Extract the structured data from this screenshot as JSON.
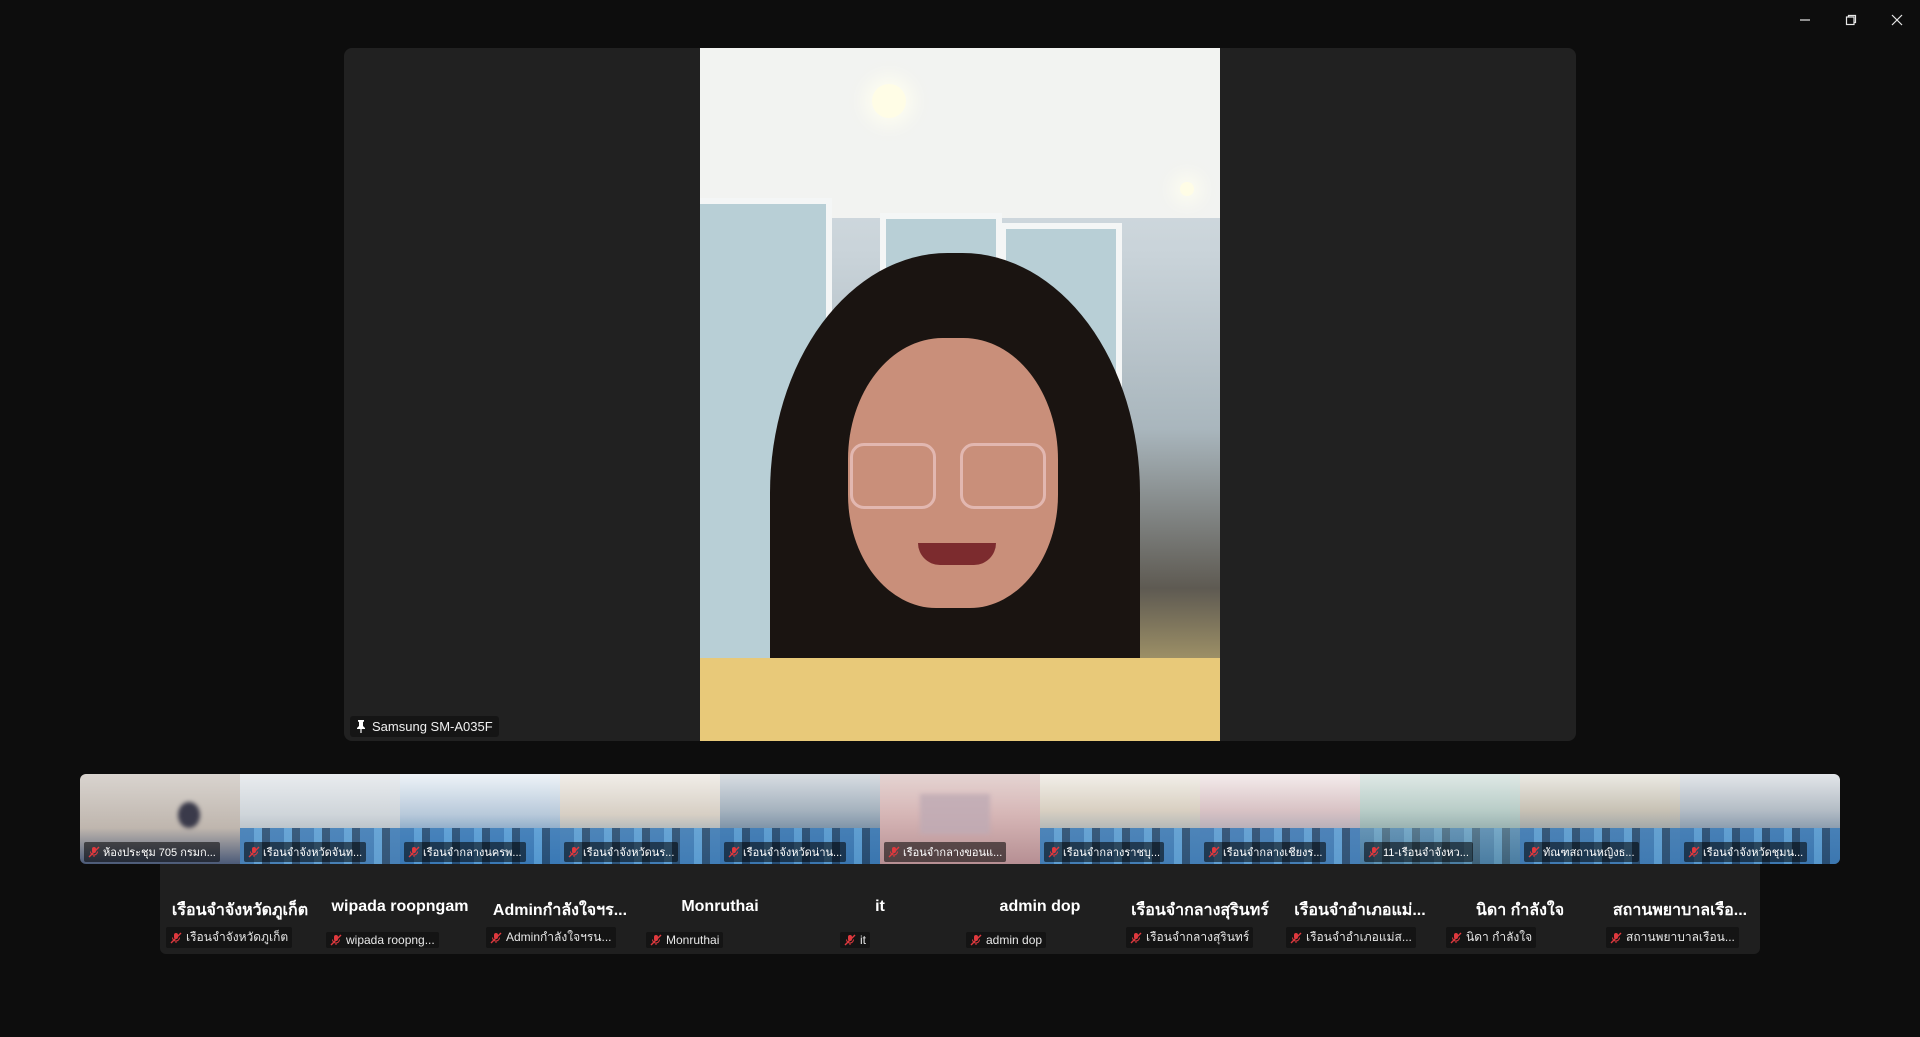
{
  "window": {
    "controls": [
      "minimize-icon",
      "restore-icon",
      "close-icon"
    ]
  },
  "main_stage": {
    "pinned_name": "Samsung SM-A035F",
    "pin_icon": "pin-icon"
  },
  "filmstrip": [
    {
      "label": "ห้องประชุม 705 กรมก..."
    },
    {
      "label": "เรือนจำจังหวัดจันท..."
    },
    {
      "label": "เรือนจำกลางนครพ..."
    },
    {
      "label": "เรือนจำจังหวัดนร..."
    },
    {
      "label": "เรือนจำจังหวัดน่าน..."
    },
    {
      "label": "เรือนจำกลางขอนแ..."
    },
    {
      "label": "เรือนจำกลางราชบุ..."
    },
    {
      "label": "เรือนจำกลางเชียงร..."
    },
    {
      "label": "11-เรือนจำจังหว..."
    },
    {
      "label": "ทัณฑสถานหญิงธ..."
    },
    {
      "label": "เรือนจำจังหวัดชุมน..."
    }
  ],
  "avatar_tiles": [
    {
      "name": "เรือนจำจังหวัดภูเก็ต",
      "sub": "เรือนจำจังหวัดภูเก็ต"
    },
    {
      "name": "wipada roopngam",
      "sub": "wipada roopng..."
    },
    {
      "name": "Adminกำลังใจฯร...",
      "sub": "Adminกำลังใจฯรน..."
    },
    {
      "name": "Monruthai",
      "sub": "Monruthai"
    },
    {
      "name": "it",
      "sub": "it"
    },
    {
      "name": "admin dop",
      "sub": "admin dop"
    },
    {
      "name": "เรือนจำกลางสุรินทร์",
      "sub": "เรือนจำกลางสุรินทร์"
    },
    {
      "name": "เรือนจำอำเภอแม่...",
      "sub": "เรือนจำอำเภอแม่ส..."
    },
    {
      "name": "นิดา กำลังใจ",
      "sub": "นิดา กำลังใจ"
    },
    {
      "name": "สถานพยาบาลเรือ...",
      "sub": "สถานพยาบาลเรือน..."
    }
  ],
  "colors": {
    "background": "#0d0d0d",
    "stage": "#212121",
    "avatar_row": "#1f1f1f",
    "mic_muted": "#e0393e"
  }
}
